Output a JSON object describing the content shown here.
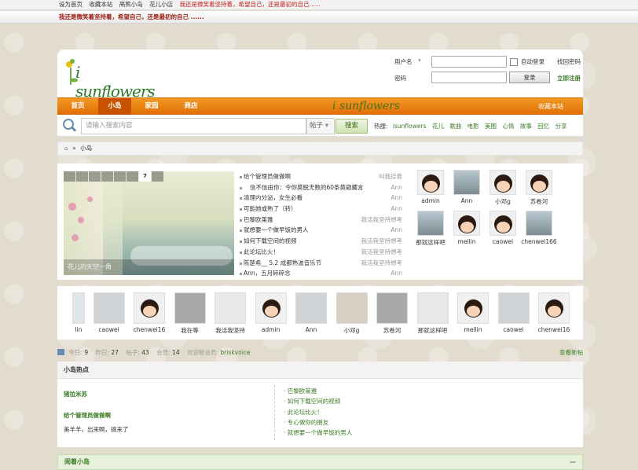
{
  "topbar": {
    "links": [
      "设为首页",
      "收藏本站",
      "鬲熊小岛",
      "花儿小店"
    ],
    "slogan": "我还是微笑着坚持着，希望自己，还是最初的自己......"
  },
  "message_bar": "我还是微笑着坚持着，希望自己，还是最初的自己 ......",
  "logo": {
    "text": "i sunflowers"
  },
  "login": {
    "username_label": "用户名",
    "password_label": "密码",
    "auto_login": "自动登录",
    "find_password": "找回密码",
    "login_button": "登录",
    "register": "立即注册"
  },
  "nav": {
    "items": [
      "首页",
      "小岛",
      "家园",
      "商店"
    ],
    "active": "小岛",
    "logo": "i sunflowers",
    "favorite": "收藏本站"
  },
  "search": {
    "placeholder": "请输入搜索内容",
    "type": "帖子",
    "button": "搜索",
    "hot_label": "热搜:",
    "hot_words": [
      "isunflowers",
      "花儿",
      "歌曲",
      "电影",
      "美图",
      "心情",
      "故事",
      "回忆",
      "分享"
    ]
  },
  "breadcrumb": {
    "sep": "»",
    "current": "小岛"
  },
  "slideshow": {
    "numbers": [
      "",
      "",
      "",
      "",
      "",
      "",
      "7",
      ""
    ],
    "active_index": 6,
    "caption": "花儿的天空一角"
  },
  "news": [
    {
      "title": "给个管理员做做啊",
      "author": "叫我挂着"
    },
    {
      "title": "信不信由你：令你莫脱无数的60条莫窥藏言",
      "author": "Ann"
    },
    {
      "title": "清理内分泌，女生必看",
      "author": "Ann"
    },
    {
      "title": "可能她或熟了（转）",
      "author": "Ann"
    },
    {
      "title": "巴黎欧莱雅",
      "author": "我活我坚持想考"
    },
    {
      "title": "就想要一个做早饭的男人",
      "author": "Ann"
    },
    {
      "title": "如何下载空间的视频",
      "author": "我活我坚持想考"
    },
    {
      "title": "此论坛比火！",
      "author": "我活我坚持想考"
    },
    {
      "title": "陈楚希__ 5.2 成都熟波音乐节",
      "author": "我活我坚持想考"
    },
    {
      "title": "Ann，五月碎碎念",
      "author": "Ann"
    }
  ],
  "users": [
    "admin",
    "Ann",
    "小邓g",
    "苏卷河",
    "那就这样吧",
    "meilin",
    "caowei",
    "chenwei166"
  ],
  "strip_users": [
    "lin",
    "caowei",
    "chenwei16",
    "我在等",
    "我活我坚持",
    "admin",
    "Ann",
    "小邓g",
    "苏卷河",
    "那就这样吧",
    "meilin",
    "caowei",
    "chenwei16"
  ],
  "stats": {
    "today_label": "今日:",
    "today": "9",
    "yesterday_label": "昨日:",
    "yesterday": "27",
    "posts_label": "帖子:",
    "posts": "43",
    "members_label": "会员:",
    "members": "14",
    "welcome": "欢迎新会员:",
    "new_member": "briskvoice",
    "right": "查看新帖"
  },
  "hot": {
    "title": "小岛热点",
    "left": [
      "猪拉米苏",
      "给个管理员做做啊",
      "美羊羊，出来啊，搞来了"
    ],
    "right": [
      "巴黎欧莱雅",
      "如何下载空间的视频",
      "此论坛比火！",
      "专心做你的朋友",
      "就想要一个做早饭的男人"
    ]
  },
  "section": {
    "title": "闹着小岛",
    "toggle": "—"
  },
  "colors": {
    "nav": "#f29a23",
    "nav_active": "#c85200",
    "link_green": "#3a7c25",
    "slogan_red": "#c0211c"
  }
}
